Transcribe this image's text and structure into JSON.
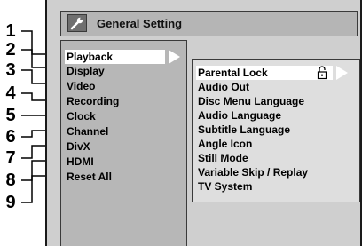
{
  "window": {
    "title": "General Setting"
  },
  "left_menu": {
    "items": [
      {
        "label": "Playback"
      },
      {
        "label": "Display"
      },
      {
        "label": "Video"
      },
      {
        "label": "Recording"
      },
      {
        "label": "Clock"
      },
      {
        "label": "Channel"
      },
      {
        "label": "DivX"
      },
      {
        "label": "HDMI"
      },
      {
        "label": "Reset All"
      }
    ],
    "selected_index": 0
  },
  "right_menu": {
    "items": [
      {
        "label": "Parental Lock"
      },
      {
        "label": "Audio Out"
      },
      {
        "label": "Disc Menu Language"
      },
      {
        "label": "Audio Language"
      },
      {
        "label": "Subtitle Language"
      },
      {
        "label": "Angle Icon"
      },
      {
        "label": "Still Mode"
      },
      {
        "label": "Variable Skip / Replay"
      },
      {
        "label": "TV System"
      }
    ],
    "selected_index": 0
  },
  "callouts": [
    "1",
    "2",
    "3",
    "4",
    "5",
    "6",
    "7",
    "8",
    "9"
  ],
  "icons": {
    "title": "wrench-icon",
    "selection": "arrow-right-icon",
    "parental_lock": "lock-icon"
  },
  "colors": {
    "screen_bg": "#cfcfcf",
    "panel_bg": "#b7b7b7",
    "submenu_bg": "#dedede",
    "highlight": "#ffffff"
  }
}
